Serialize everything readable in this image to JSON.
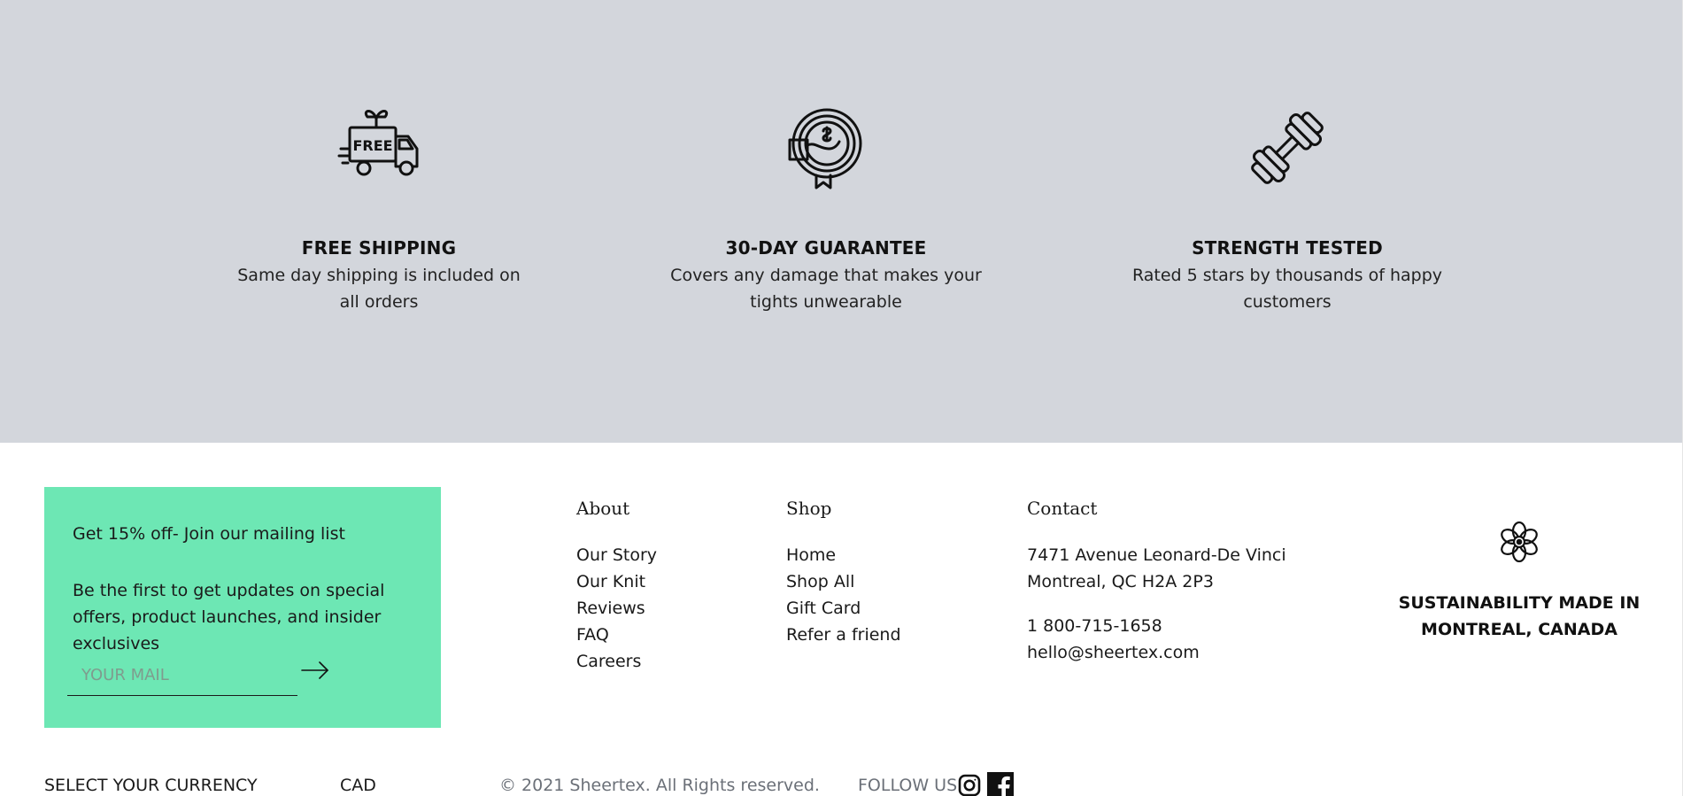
{
  "features": [
    {
      "icon": "free-delivery-truck-icon",
      "title": "FREE SHIPPING",
      "description": "Same day shipping is included on all orders"
    },
    {
      "icon": "guarantee-badge-icon",
      "title": "30-DAY GUARANTEE",
      "description": "Covers any damage that makes your tights unwearable"
    },
    {
      "icon": "dumbbell-icon",
      "title": "STRENGTH TESTED",
      "description": "Rated 5 stars by thousands of happy customers"
    }
  ],
  "newsletter": {
    "title": "Get 15% off- Join our mailing list",
    "description": "Be the first to get updates on special offers, product launches, and insider exclusives",
    "input_placeholder": "YOUR MAIL",
    "submit_icon": "arrow-right-icon",
    "background": "#6de7b4"
  },
  "about": {
    "title": "About",
    "links": [
      "Our Story",
      "Our Knit",
      "Reviews",
      "FAQ",
      "Careers"
    ]
  },
  "shop": {
    "title": "Shop",
    "links": [
      "Home",
      "Shop All",
      "Gift Card",
      "Refer a friend"
    ]
  },
  "contact": {
    "title": "Contact",
    "address_line1": "7471 Avenue Leonard-De Vinci",
    "address_line2": "Montreal, QC H2A 2P3",
    "phone": "1 800-715-1658",
    "email": "hello@sheertex.com"
  },
  "brand": {
    "icon": "flower-logo-icon",
    "slogan": "SUSTAINABILITY MADE IN MONTREAL, CANADA"
  },
  "bottom": {
    "currency_label": "SELECT YOUR CURRENCY",
    "currency_value": "CAD",
    "copyright": "© 2021 Sheertex. All Rights reserved.",
    "follow_label": "FOLLOW US",
    "social": [
      "instagram-icon",
      "facebook-icon"
    ]
  },
  "colors": {
    "features_background": "#d3d6dc",
    "footer_background": "#ffffff"
  }
}
